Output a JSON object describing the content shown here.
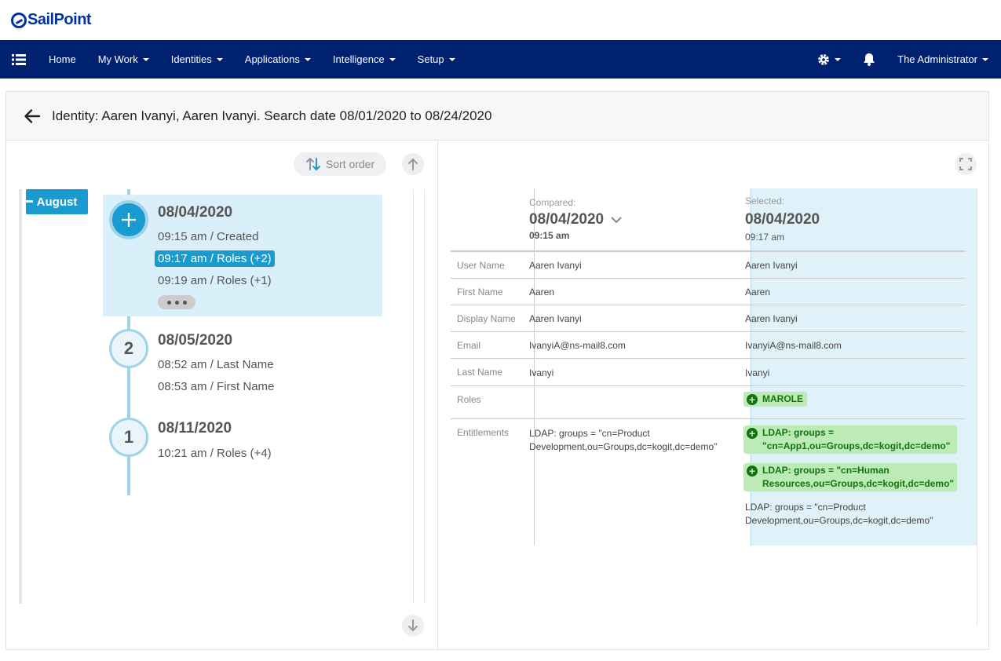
{
  "logo": {
    "text": "SailPoint"
  },
  "nav": {
    "home": "Home",
    "my_work": "My Work",
    "identities": "Identities",
    "applications": "Applications",
    "intelligence": "Intelligence",
    "setup": "Setup",
    "user": "The Administrator"
  },
  "page": {
    "title": "Identity: Aaren Ivanyi, Aaren Ivanyi. Search date 08/01/2020 to 08/24/2020"
  },
  "timeline": {
    "sort_label": "Sort order",
    "month": "August",
    "days": [
      {
        "node": "+",
        "date": "08/04/2020",
        "events": [
          "09:15 am / Created",
          "09:17 am / Roles (+2)",
          "09:19 am / Roles (+1)"
        ]
      },
      {
        "node": "2",
        "date": "08/05/2020",
        "events": [
          "08:52 am / Last Name",
          "08:53 am / First Name"
        ]
      },
      {
        "node": "1",
        "date": "08/11/2020",
        "events": [
          "10:21 am / Roles (+4)"
        ]
      }
    ]
  },
  "compare": {
    "compared_label": "Compared:",
    "compared_date": "08/04/2020",
    "compared_time": "09:15 am",
    "selected_label": "Selected:",
    "selected_date": "08/04/2020",
    "selected_time": "09:17 am",
    "rows": [
      {
        "label": "User Name",
        "compared": "Aaren Ivanyi",
        "selected": "Aaren Ivanyi"
      },
      {
        "label": "First Name",
        "compared": "Aaren",
        "selected": "Aaren"
      },
      {
        "label": "Display Name",
        "compared": "Aaren Ivanyi",
        "selected": "Aaren Ivanyi"
      },
      {
        "label": "Email",
        "compared": "IvanyiA@ns-mail8.com",
        "selected": "IvanyiA@ns-mail8.com"
      },
      {
        "label": "Last Name",
        "compared": "Ivanyi",
        "selected": "Ivanyi"
      },
      {
        "label": "Roles",
        "compared": "",
        "selected_added": "MAROLE"
      },
      {
        "label": "Entitlements",
        "compared": "LDAP: groups = \"cn=Product Development,ou=Groups,dc=kogit,dc=demo\"",
        "selected_added_1": "LDAP: groups = \"cn=App1,ou=Groups,dc=kogit,dc=demo\"",
        "selected_added_2": "LDAP: groups = \"cn=Human Resources,ou=Groups,dc=kogit,dc=demo\"",
        "selected": "LDAP: groups = \"cn=Product Development,ou=Groups,dc=kogit,dc=demo\""
      }
    ]
  },
  "colors": {
    "nav_bg": "#002070",
    "accent": "#1a9bd0",
    "added_bg": "#bcebb6",
    "added_text": "#127212"
  }
}
